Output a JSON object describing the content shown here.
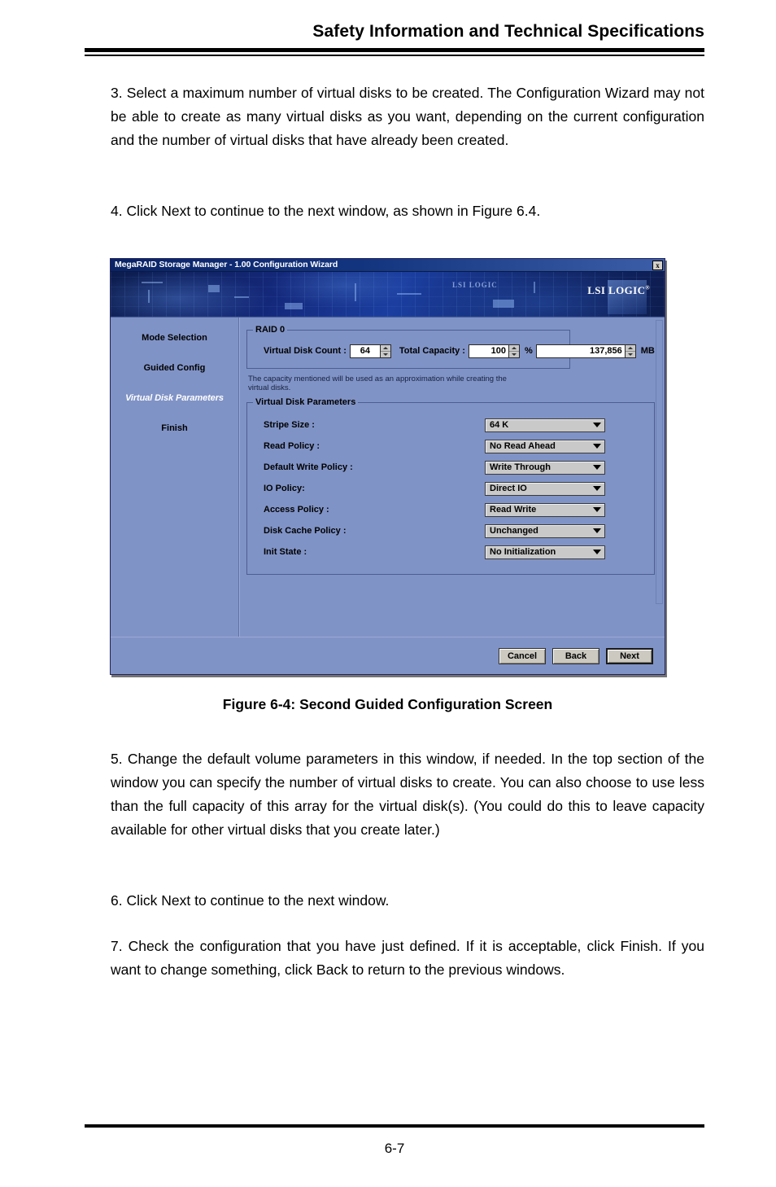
{
  "header": {
    "title": "Safety Information and Technical Specifications"
  },
  "paragraphs": {
    "step3": "3. Select a maximum number of virtual disks to be created. The Configuration Wizard may not be able to create as many virtual disks as you want, depending on the current configuration and the number of virtual disks that have already been created.",
    "step4": "4. Click Next to continue to the next window, as shown in Figure 6.4.",
    "step5": "5. Change the default volume parameters in this window, if needed. In the top section of the window you can specify the number of virtual disks to create. You can also choose to use less than the full capacity of this array for the virtual disk(s). (You could do this to leave capacity available for other virtual disks that you create later.)",
    "step6": "6. Click Next to continue to the next window.",
    "step7": "7. Check the configuration that you have just defined. If it is acceptable, click Finish. If you want to change something, click Back to return to the previous windows."
  },
  "figure": {
    "caption": "Figure 6-4: Second Guided Configuration Screen",
    "dialog": {
      "title": "MegaRAID Storage Manager - 1.00 Configuration Wizard",
      "close_label": "x",
      "banner": {
        "logo_text": "LSI LOGIC",
        "logo_registered": "®",
        "ghost_logo_text": "LSI LOGIC"
      },
      "steps": [
        {
          "label": "Mode Selection",
          "active": false
        },
        {
          "label": "Guided Config",
          "active": false
        },
        {
          "label": "Virtual Disk Parameters",
          "active": true
        },
        {
          "label": "Finish",
          "active": false
        }
      ],
      "raid_group": {
        "legend": "RAID 0",
        "virtual_disk_count_label": "Virtual Disk Count :",
        "virtual_disk_count_value": "64",
        "total_capacity_label": "Total Capacity :",
        "total_capacity_percent": "100",
        "percent_unit": "%",
        "total_capacity_mb": "137,856",
        "mb_unit": "MB",
        "note": "The capacity mentioned will be used as an approximation while creating the virtual disks."
      },
      "params_group": {
        "legend": "Virtual Disk Parameters",
        "rows": [
          {
            "label": "Stripe Size :",
            "value": "64 K"
          },
          {
            "label": "Read Policy :",
            "value": "No Read Ahead"
          },
          {
            "label": "Default Write Policy :",
            "value": "Write Through"
          },
          {
            "label": "IO Policy:",
            "value": "Direct IO"
          },
          {
            "label": "Access Policy :",
            "value": "Read Write"
          },
          {
            "label": "Disk Cache Policy :",
            "value": "Unchanged"
          },
          {
            "label": "Init State :",
            "value": "No Initialization"
          }
        ]
      },
      "buttons": {
        "cancel": "Cancel",
        "back": "Back",
        "next": "Next"
      }
    }
  },
  "footer": {
    "page_number": "6-7"
  },
  "colors": {
    "dialog_background": "#8093c6",
    "titlebar": "#12347f",
    "banner_blue": "#14287a",
    "combo_gray": "#c9c9c9",
    "button_face": "#ccc9c1",
    "active_step": "#ffffff"
  }
}
